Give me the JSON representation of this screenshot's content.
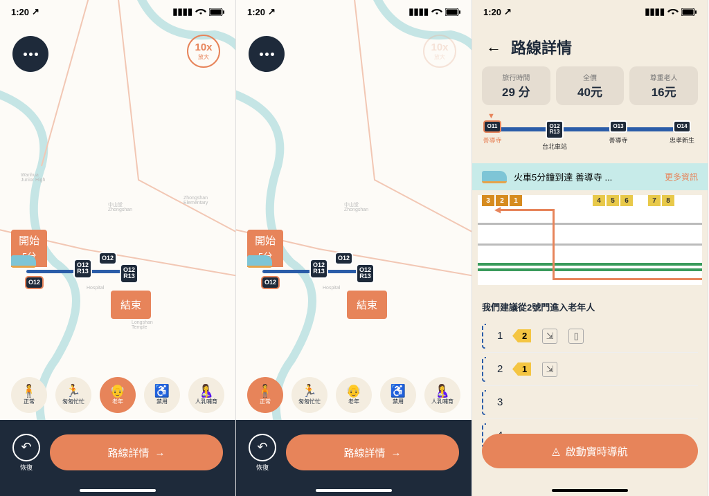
{
  "status": {
    "time": "1:20",
    "loc_arrow": "↗"
  },
  "zoom": {
    "level": "10x",
    "label": "放大"
  },
  "start": {
    "label": "開始",
    "time": "5分"
  },
  "end": {
    "label": "結束"
  },
  "station_badges": {
    "origin": "O12",
    "b1_l1": "O12",
    "b1_l2": "R13",
    "b2": "O12",
    "b3_l1": "O12",
    "b3_l2": "R13"
  },
  "modes": {
    "normal": "正常",
    "hurry": "匆匆忙忙",
    "elder": "老年",
    "disabled": "禁用",
    "nursing": "人乳哺育"
  },
  "bottom": {
    "undo": "恢復",
    "route": "路線詳情"
  },
  "s3": {
    "title": "路線詳情",
    "stats": {
      "time_l": "旅行時間",
      "time_v": "29 分",
      "fare_l": "全價",
      "fare_v": "40元",
      "elder_l": "尊重老人",
      "elder_v": "16元"
    },
    "stops": [
      {
        "code": "O11",
        "code2": "",
        "name": "善導寺",
        "origin": true
      },
      {
        "code": "O12",
        "code2": "R13",
        "name": "台北車站"
      },
      {
        "code": "O13",
        "code2": "",
        "name": "善導寺"
      },
      {
        "code": "O14",
        "code2": "",
        "name": "忠孝新生"
      }
    ],
    "arrival": "火車5分鐘到達 善導寺 ...",
    "more": "更多資訊",
    "advice": "我們建議從2號門進入老年人",
    "door1": "2",
    "door2": "1",
    "cars": [
      "1",
      "2",
      "3",
      "4"
    ],
    "nav": "啟動實時導航",
    "platforms": [
      "3",
      "2",
      "1",
      "4",
      "5",
      "6",
      "7",
      "8"
    ]
  }
}
